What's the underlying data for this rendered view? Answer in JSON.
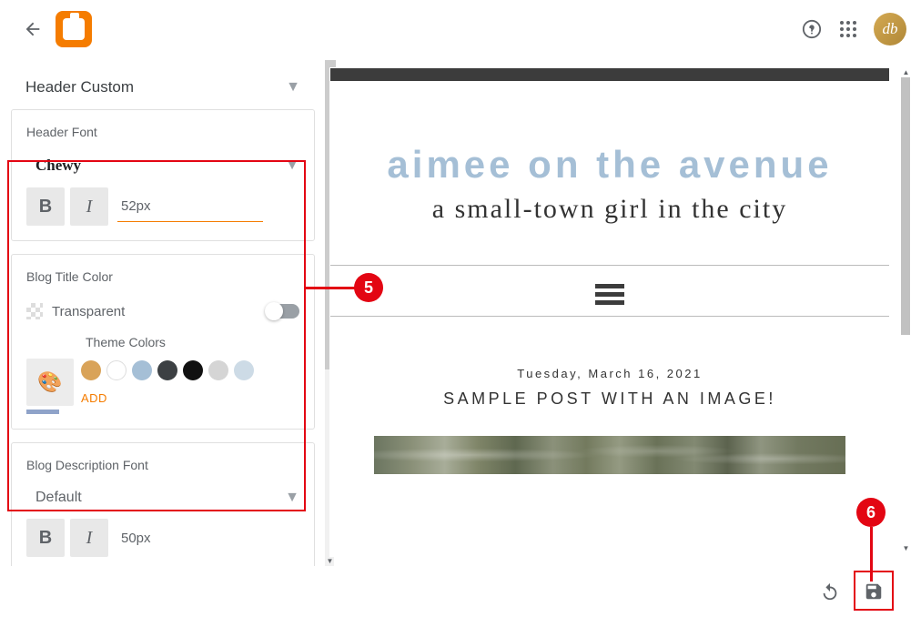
{
  "topbar": {
    "avatar_initials": "db"
  },
  "sidebar": {
    "header_dropdown": {
      "label": "Header Custom"
    },
    "header_font": {
      "section_label": "Header Font",
      "font_name": "Chewy",
      "size": "52px"
    },
    "blog_title_color": {
      "section_label": "Blog Title Color",
      "transparent_label": "Transparent",
      "theme_colors_label": "Theme Colors",
      "swatches": [
        "#d9a359",
        "#ffffff",
        "#a5bfd6",
        "#3c4043",
        "#111111",
        "#d5d5d5",
        "#cddbe6"
      ],
      "add_label": "ADD"
    },
    "blog_description_font": {
      "section_label": "Blog Description Font",
      "font_name": "Default",
      "size": "50px"
    }
  },
  "preview": {
    "blog_title": "aimee on the avenue",
    "blog_subtitle": "a small-town girl in the city",
    "post_date": "Tuesday, March 16, 2021",
    "post_title": "SAMPLE POST WITH AN IMAGE!"
  },
  "callouts": {
    "five": "5",
    "six": "6"
  }
}
